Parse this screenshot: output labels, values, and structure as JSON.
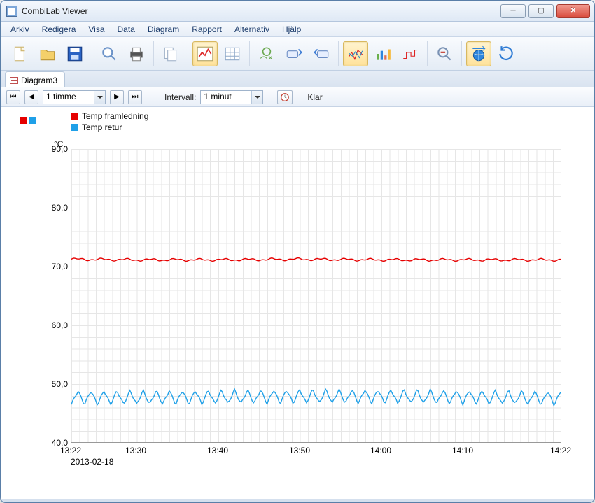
{
  "window": {
    "title": "CombiLab Viewer"
  },
  "menu": [
    "Arkiv",
    "Redigera",
    "Visa",
    "Data",
    "Diagram",
    "Rapport",
    "Alternativ",
    "Hjälp"
  ],
  "tabs": [
    {
      "label": "Diagram3"
    }
  ],
  "controls": {
    "timespan_value": "1 timme",
    "interval_label": "Intervall:",
    "interval_value": "1 minut",
    "status": "Klar"
  },
  "legend": {
    "items": [
      {
        "label": "Temp framledning",
        "color": "#e60000"
      },
      {
        "label": "Temp retur",
        "color": "#1fa0e8"
      }
    ]
  },
  "chart_data": {
    "type": "line",
    "ylabel": "°C",
    "ylim": [
      40.0,
      90.0
    ],
    "yticks": [
      "40,0",
      "50,0",
      "60,0",
      "70,0",
      "80,0",
      "90,0"
    ],
    "xticks": [
      "13:22",
      "13:30",
      "13:40",
      "13:50",
      "14:00",
      "14:10",
      "14:22"
    ],
    "xdate": "2013-02-18",
    "x_time_range_minutes": [
      0,
      60
    ],
    "series": [
      {
        "name": "Temp framledning",
        "color": "#e60000",
        "description": "nearly flat around 71 °C",
        "values_at_xticks": [
          71.2,
          71.1,
          71.1,
          71.2,
          71.1,
          71.1,
          71.1
        ]
      },
      {
        "name": "Temp retur",
        "color": "#1fa0e8",
        "description": "oscillating approx 46.5–49 °C, period ≈ 1.6 min",
        "values_at_xticks": [
          47.6,
          47.6,
          47.7,
          47.8,
          47.8,
          47.7,
          47.5
        ],
        "oscillation_amplitude": 1.3,
        "oscillation_period_minutes": 1.6
      }
    ]
  }
}
